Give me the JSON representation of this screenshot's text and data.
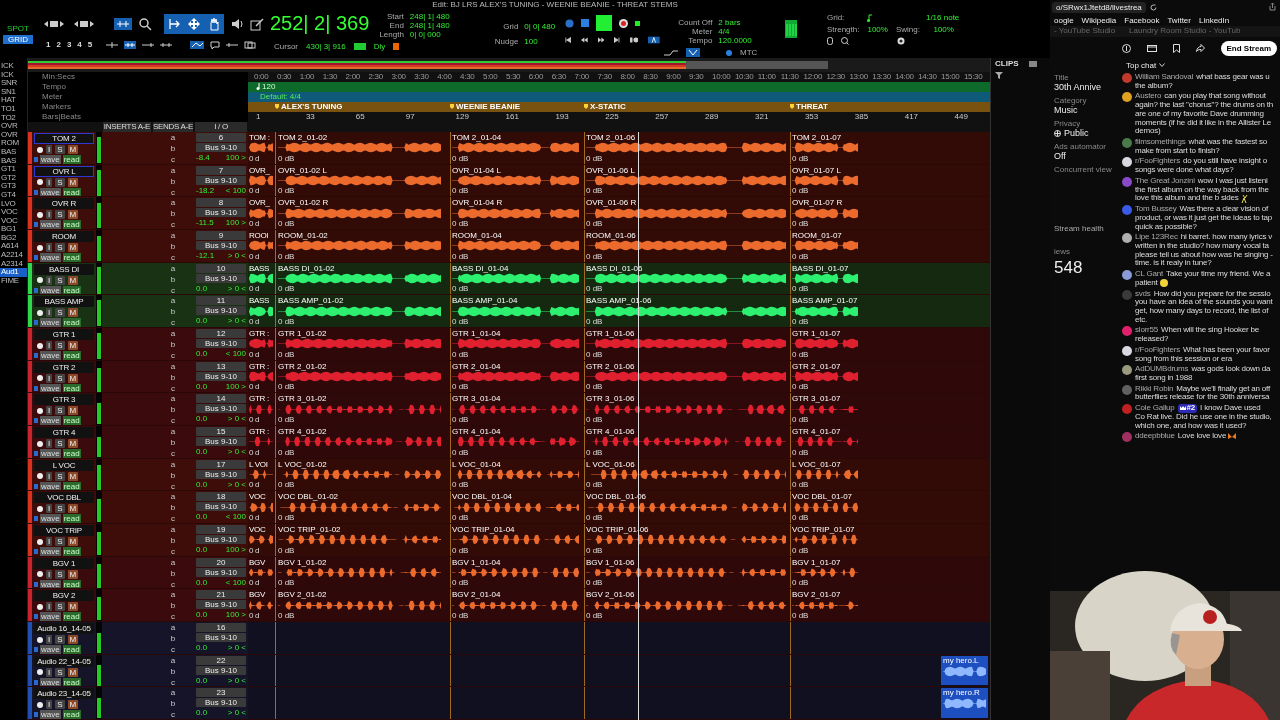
{
  "toolbar": {
    "title": "Edit: BJ LRS ALEX'S TUNING - WEENIE BEANIE - THREAT STEMS",
    "edit_modes": [
      {
        "label": "SPOT",
        "selected": false
      },
      {
        "label": "GRID",
        "selected": true
      }
    ],
    "zoom_presets": [
      "1",
      "2",
      "3",
      "4",
      "5"
    ],
    "main_counter": "252| 2| 369",
    "selection": [
      {
        "label": "Start",
        "value": "248| 1| 480"
      },
      {
        "label": "End",
        "value": "248| 1| 480"
      },
      {
        "label": "Length",
        "value": "0| 0| 000"
      }
    ],
    "cursor": {
      "label": "Cursor",
      "value": "430| 3| 916"
    },
    "dly": "Dly",
    "grid": {
      "label": "Grid",
      "value": "0| 0| 480"
    },
    "nudge": {
      "label": "Nudge",
      "value": "100"
    },
    "count_off": [
      {
        "label": "Count Off",
        "value": "2 bars"
      },
      {
        "label": "Meter",
        "value": "4/4"
      },
      {
        "label": "Tempo",
        "value": "120.0000"
      }
    ],
    "mtc": "MTC",
    "quantize": [
      {
        "label": "Grid:",
        "value": "1/16 note"
      },
      {
        "label": "Strength:",
        "value": "100%"
      },
      {
        "label": "Swing:",
        "value": "100%"
      }
    ]
  },
  "track_list": [
    {
      "name": "ICK",
      "selected": false
    },
    {
      "name": "ICK",
      "selected": false
    },
    {
      "name": "SNR",
      "selected": false
    },
    {
      "name": "SN1",
      "selected": false
    },
    {
      "name": "HAT",
      "selected": false
    },
    {
      "name": "TO1",
      "selected": false
    },
    {
      "name": "TO2",
      "selected": false
    },
    {
      "name": "OVR",
      "selected": false
    },
    {
      "name": "OVR",
      "selected": false
    },
    {
      "name": "ROM",
      "selected": false
    },
    {
      "name": "BAS",
      "selected": false
    },
    {
      "name": "BAS",
      "selected": false
    },
    {
      "name": "GT1",
      "selected": false
    },
    {
      "name": "GT2",
      "selected": false
    },
    {
      "name": "GT3",
      "selected": false
    },
    {
      "name": "GT4",
      "selected": false
    },
    {
      "name": "LVO",
      "selected": false
    },
    {
      "name": "VOC",
      "selected": false
    },
    {
      "name": "VOC",
      "selected": false
    },
    {
      "name": "BG1",
      "selected": false
    },
    {
      "name": "BG2",
      "selected": false
    },
    {
      "name": "A614",
      "selected": false
    },
    {
      "name": "A2214",
      "selected": false
    },
    {
      "name": "A2314",
      "selected": false
    },
    {
      "name": "Aud1",
      "selected": true
    },
    {
      "name": "FIME",
      "selected": false
    }
  ],
  "rulers": {
    "min_secs": {
      "label": "Min:Secs",
      "ticks": [
        "0:00",
        "0:30",
        "1:00",
        "1:30",
        "2:00",
        "2:30",
        "3:00",
        "3:30",
        "4:00",
        "4:30",
        "5:00",
        "5:30",
        "6:00",
        "6:30",
        "7:00",
        "7:30",
        "8:00",
        "8:30",
        "9:00",
        "9:30",
        "10:00",
        "10:30",
        "11:00",
        "11:30",
        "12:00",
        "12:30",
        "13:00",
        "13:30",
        "14:00",
        "14:30",
        "15:00",
        "15:30"
      ]
    },
    "tempo": {
      "label": "Tempo",
      "value": "120"
    },
    "meter": {
      "label": "Meter",
      "value": "Default: 4/4"
    },
    "markers": {
      "label": "Markers",
      "items": [
        "ALEX'S TUNING",
        "WEENIE BEANIE",
        "X-STATIC",
        "THREAT"
      ]
    },
    "bars_beats": {
      "label": "Bars|Beats",
      "ticks": [
        "1",
        "33",
        "65",
        "97",
        "129",
        "161",
        "193",
        "225",
        "257",
        "289",
        "321",
        "353",
        "385",
        "417",
        "449"
      ]
    }
  },
  "column_headers": [
    "INSERTS A-E",
    "SENDS A-E",
    "I / O"
  ],
  "clips_panel": {
    "title": "CLIPS"
  },
  "tracks": [
    {
      "name": "TOM 2",
      "selected": true,
      "color": "#d8321e",
      "kind": "drums",
      "level": 0.9,
      "controls": [
        "I",
        "S",
        "M"
      ],
      "view": "wave",
      "automation": "read",
      "sends": [
        "a",
        "b",
        "c"
      ],
      "input": "6",
      "output": "Bus 9-10",
      "volume": "-8.4",
      "pan": "100 >",
      "clips": [
        {
          "name": "TOM :",
          "gain": "0 d"
        },
        {
          "name": "TOM 2_01-02",
          "gain": "0 dB"
        },
        {
          "name": "TOM 2_01-04",
          "gain": "0 dB"
        },
        {
          "name": "TOM 2_01-06",
          "gain": "0 dB"
        },
        {
          "name": "TOM 2_01-07",
          "gain": "0 dB"
        }
      ]
    },
    {
      "name": "OVR L",
      "selected": true,
      "color": "#d8321e",
      "kind": "drums",
      "level": 0.88,
      "controls": [
        "I",
        "S",
        "M"
      ],
      "view": "wave",
      "automation": "read",
      "sends": [
        "a",
        "b",
        "c"
      ],
      "input": "7",
      "output": "Bus 9-10",
      "volume": "-18.2",
      "pan": "< 100",
      "clips": [
        {
          "name": "OVR_",
          "gain": "0 d"
        },
        {
          "name": "OVR_01-02 L",
          "gain": "0 dB"
        },
        {
          "name": "OVR_01-04 L",
          "gain": "0 dB"
        },
        {
          "name": "OVR_01-06 L",
          "gain": "0 dB"
        },
        {
          "name": "OVR_01-07 L",
          "gain": "0 dB"
        }
      ]
    },
    {
      "name": "OVR R",
      "selected": false,
      "color": "#d8321e",
      "kind": "drums",
      "level": 0.88,
      "controls": [
        "I",
        "S",
        "M"
      ],
      "view": "wave",
      "automation": "read",
      "sends": [
        "a",
        "b",
        "c"
      ],
      "input": "8",
      "output": "Bus 9-10",
      "volume": "-11.5",
      "pan": "100 >",
      "clips": [
        {
          "name": "OVR_",
          "gain": "0 d"
        },
        {
          "name": "OVR_01-02 R",
          "gain": "0 dB"
        },
        {
          "name": "OVR_01-04 R",
          "gain": "0 dB"
        },
        {
          "name": "OVR_01-06 R",
          "gain": "0 dB"
        },
        {
          "name": "OVR_01-07 R",
          "gain": "0 dB"
        }
      ]
    },
    {
      "name": "ROOM",
      "selected": false,
      "color": "#d8321e",
      "kind": "drums",
      "level": 0.86,
      "controls": [
        "I",
        "S",
        "M"
      ],
      "view": "wave",
      "automation": "read",
      "sends": [
        "a",
        "b",
        "c"
      ],
      "input": "9",
      "output": "Bus 9-10",
      "volume": "-12.1",
      "pan": "> 0 <",
      "clips": [
        {
          "name": "ROOI",
          "gain": "0 d"
        },
        {
          "name": "ROOM_01-02",
          "gain": "0 dB"
        },
        {
          "name": "ROOM_01-04",
          "gain": "0 dB"
        },
        {
          "name": "ROOM_01-06",
          "gain": "0 dB"
        },
        {
          "name": "ROOM_01-07",
          "gain": "0 dB"
        }
      ]
    },
    {
      "name": "BASS DI",
      "selected": false,
      "color": "#2ed84a",
      "kind": "bass",
      "level": 0.92,
      "controls": [
        "I",
        "S",
        "M"
      ],
      "view": "wave",
      "automation": "read",
      "sends": [
        "a",
        "b",
        "c"
      ],
      "input": "10",
      "output": "Bus 9-10",
      "volume": "0.0",
      "pan": "> 0 <",
      "clips": [
        {
          "name": "BASS",
          "gain": "0 d"
        },
        {
          "name": "BASS DI_01-02",
          "gain": "0 dB"
        },
        {
          "name": "BASS DI_01-04",
          "gain": "0 dB"
        },
        {
          "name": "BASS DI_01-06",
          "gain": "0 dB"
        },
        {
          "name": "BASS DI_01-07",
          "gain": "0 dB"
        }
      ]
    },
    {
      "name": "BASS AMP",
      "selected": false,
      "color": "#2ed84a",
      "kind": "bass",
      "level": 0.9,
      "controls": [
        "I",
        "S",
        "M"
      ],
      "view": "wave",
      "automation": "read",
      "sends": [
        "a",
        "b",
        "c"
      ],
      "input": "11",
      "output": "Bus 9-10",
      "volume": "0.0",
      "pan": "> 0 <",
      "clips": [
        {
          "name": "BASS",
          "gain": "0 d"
        },
        {
          "name": "BASS AMP_01-02",
          "gain": "0 dB"
        },
        {
          "name": "BASS AMP_01-04",
          "gain": "0 dB"
        },
        {
          "name": "BASS AMP_01-06",
          "gain": "0 dB"
        },
        {
          "name": "BASS AMP_01-07",
          "gain": "0 dB"
        }
      ]
    },
    {
      "name": "GTR 1",
      "selected": false,
      "color": "#c8242c",
      "kind": "guitar",
      "level": 0.9,
      "controls": [
        "I",
        "S",
        "M"
      ],
      "view": "wave",
      "automation": "read",
      "sends": [
        "a",
        "b",
        "c"
      ],
      "input": "12",
      "output": "Bus 9-10",
      "volume": "0.0",
      "pan": "< 100",
      "clips": [
        {
          "name": "GTR :",
          "gain": "0 d"
        },
        {
          "name": "GTR 1_01-02",
          "gain": "0 dB"
        },
        {
          "name": "GTR 1_01-04",
          "gain": "0 dB"
        },
        {
          "name": "GTR 1_01-06",
          "gain": "0 dB"
        },
        {
          "name": "GTR 1_01-07",
          "gain": "0 dB"
        }
      ]
    },
    {
      "name": "GTR 2",
      "selected": false,
      "color": "#c8242c",
      "kind": "guitar",
      "level": 0.8,
      "controls": [
        "I",
        "S",
        "M"
      ],
      "view": "wave",
      "automation": "read",
      "sends": [
        "a",
        "b",
        "c"
      ],
      "input": "13",
      "output": "Bus 9-10",
      "volume": "0.0",
      "pan": "100 >",
      "clips": [
        {
          "name": "GTR :",
          "gain": "0 d"
        },
        {
          "name": "GTR 2_01-02",
          "gain": "0 dB"
        },
        {
          "name": "GTR 2_01-04",
          "gain": "0 dB"
        },
        {
          "name": "GTR 2_01-06",
          "gain": "0 dB"
        },
        {
          "name": "GTR 2_01-07",
          "gain": "0 dB"
        }
      ]
    },
    {
      "name": "GTR 3",
      "selected": false,
      "color": "#c8242c",
      "kind": "guitar",
      "level": 0.75,
      "controls": [
        "I",
        "S",
        "M"
      ],
      "view": "wave",
      "automation": "read",
      "sends": [
        "a",
        "b",
        "c"
      ],
      "input": "14",
      "output": "Bus 9-10",
      "volume": "0.0",
      "pan": "> 0 <",
      "clips": [
        {
          "name": "GTR :",
          "gain": "0 d"
        },
        {
          "name": "GTR 3_01-02",
          "gain": "0 dB"
        },
        {
          "name": "GTR 3_01-04",
          "gain": "0 dB"
        },
        {
          "name": "GTR 3_01-06",
          "gain": "0 dB"
        },
        {
          "name": "GTR 3_01-07",
          "gain": "0 dB"
        }
      ]
    },
    {
      "name": "GTR 4",
      "selected": false,
      "color": "#c8242c",
      "kind": "guitar",
      "level": 0.7,
      "controls": [
        "I",
        "S",
        "M"
      ],
      "view": "wave",
      "automation": "read",
      "sends": [
        "a",
        "b",
        "c"
      ],
      "input": "15",
      "output": "Bus 9-10",
      "volume": "0.0",
      "pan": "> 0 <",
      "clips": [
        {
          "name": "GTR :",
          "gain": "0 d"
        },
        {
          "name": "GTR 4_01-02",
          "gain": "0 dB"
        },
        {
          "name": "GTR 4_01-04",
          "gain": "0 dB"
        },
        {
          "name": "GTR 4_01-06",
          "gain": "0 dB"
        },
        {
          "name": "GTR 4_01-07",
          "gain": "0 dB"
        }
      ]
    },
    {
      "name": "L VOC",
      "selected": false,
      "color": "#d8321e",
      "kind": "vocal",
      "level": 0.85,
      "controls": [
        "I",
        "S",
        "M"
      ],
      "view": "wave",
      "automation": "read",
      "sends": [
        "a",
        "b",
        "c"
      ],
      "input": "17",
      "output": "Bus 9-10",
      "volume": "0.0",
      "pan": "> 0 <",
      "clips": [
        {
          "name": "L VOI",
          "gain": "0 d"
        },
        {
          "name": "L VOC_01-02",
          "gain": "0 dB"
        },
        {
          "name": "L VOC_01-04",
          "gain": "0 dB"
        },
        {
          "name": "L VOC_01-06",
          "gain": "0 dB"
        },
        {
          "name": "L VOC_01-07",
          "gain": "0 dB"
        }
      ]
    },
    {
      "name": "VOC DBL",
      "selected": false,
      "color": "#d8321e",
      "kind": "vocal",
      "level": 0.8,
      "controls": [
        "I",
        "S",
        "M"
      ],
      "view": "wave",
      "automation": "read",
      "sends": [
        "a",
        "b",
        "c"
      ],
      "input": "18",
      "output": "Bus 9-10",
      "volume": "0.0",
      "pan": "< 100",
      "clips": [
        {
          "name": "VOC",
          "gain": "0 d"
        },
        {
          "name": "VOC DBL_01-02",
          "gain": "0 dB"
        },
        {
          "name": "VOC DBL_01-04",
          "gain": "0 dB"
        },
        {
          "name": "VOC DBL_01-06",
          "gain": "0 dB"
        },
        {
          "name": "VOC DBL_01-07",
          "gain": "0 dB"
        }
      ]
    },
    {
      "name": "VOC TRIP",
      "selected": false,
      "color": "#d8321e",
      "kind": "vocal",
      "level": 0.8,
      "controls": [
        "I",
        "S",
        "M"
      ],
      "view": "wave",
      "automation": "read",
      "sends": [
        "a",
        "b",
        "c"
      ],
      "input": "19",
      "output": "Bus 9-10",
      "volume": "0.0",
      "pan": "100 >",
      "clips": [
        {
          "name": "VOC",
          "gain": "0 d"
        },
        {
          "name": "VOC TRIP_01-02",
          "gain": "0 dB"
        },
        {
          "name": "VOC TRIP_01-04",
          "gain": "0 dB"
        },
        {
          "name": "VOC TRIP_01-06",
          "gain": "0 dB"
        },
        {
          "name": "VOC TRIP_01-07",
          "gain": "0 dB"
        }
      ]
    },
    {
      "name": "BGV 1",
      "selected": false,
      "color": "#c8242c",
      "kind": "vocal",
      "level": 0.8,
      "controls": [
        "I",
        "S",
        "M"
      ],
      "view": "wave",
      "automation": "read",
      "sends": [
        "a",
        "b",
        "c"
      ],
      "input": "20",
      "output": "Bus 9-10",
      "volume": "0.0",
      "pan": "< 100",
      "clips": [
        {
          "name": "BGV",
          "gain": "0 d"
        },
        {
          "name": "BGV 1_01-02",
          "gain": "0 dB"
        },
        {
          "name": "BGV 1_01-04",
          "gain": "0 dB"
        },
        {
          "name": "BGV 1_01-06",
          "gain": "0 dB"
        },
        {
          "name": "BGV 1_01-07",
          "gain": "0 dB"
        }
      ]
    },
    {
      "name": "BGV 2",
      "selected": false,
      "color": "#c8242c",
      "kind": "vocal",
      "level": 0.8,
      "controls": [
        "I",
        "S",
        "M"
      ],
      "view": "wave",
      "automation": "read",
      "sends": [
        "a",
        "b",
        "c"
      ],
      "input": "21",
      "output": "Bus 9-10",
      "volume": "0.0",
      "pan": "100 >",
      "clips": [
        {
          "name": "BGV",
          "gain": "0 d"
        },
        {
          "name": "BGV 2_01-02",
          "gain": "0 dB"
        },
        {
          "name": "BGV 2_01-04",
          "gain": "0 dB"
        },
        {
          "name": "BGV 2_01-06",
          "gain": "0 dB"
        },
        {
          "name": "BGV 2_01-07",
          "gain": "0 dB"
        }
      ]
    },
    {
      "name": "Audio 16_14-05",
      "selected": false,
      "color": "#1f4fb0",
      "kind": "aux",
      "level": 0.7,
      "controls": [
        "I",
        "S",
        "M"
      ],
      "view": "wave",
      "automation": "read",
      "sends": [
        "a",
        "b",
        "c"
      ],
      "input": "16",
      "output": "Bus 9-10",
      "volume": "0.0",
      "pan": "> 0 <"
    },
    {
      "name": "Audio 22_14-05",
      "selected": false,
      "color": "#1f4fb0",
      "kind": "aux",
      "level": 0.7,
      "controls": [
        "I",
        "S",
        "M"
      ],
      "view": "wave",
      "automation": "read",
      "sends": [
        "a",
        "b",
        "c"
      ],
      "input": "22",
      "output": "Bus 9-10",
      "volume": "0.0",
      "pan": "> 0 <",
      "clips": [
        {
          "name": "my hero.L"
        }
      ]
    },
    {
      "name": "Audio 23_14-05",
      "selected": false,
      "color": "#1f4fb0",
      "kind": "aux",
      "level": 0.7,
      "controls": [
        "I",
        "S",
        "M"
      ],
      "view": "wave",
      "automation": "read",
      "sends": [
        "a",
        "b",
        "c"
      ],
      "input": "23",
      "output": "Bus 9-10",
      "volume": "0.0",
      "pan": "> 0 <",
      "clips": [
        {
          "name": "my hero.R"
        }
      ]
    }
  ],
  "browser": {
    "url": "o/SRwx1Jtetd8/livestrea",
    "bookmarks": [
      "oogle",
      "Wikipedia",
      "Facebook",
      "Twitter",
      "LinkedIn"
    ],
    "tabs": [
      "- YouTube Studio",
      "Laundry Room Studio - YouTub"
    ]
  },
  "studio": {
    "end_stream": "End Stream",
    "chat_mode": "Top chat",
    "details": [
      {
        "label": "Title",
        "value": "30th Annive"
      },
      {
        "label": "Category",
        "value": "Music"
      },
      {
        "label": "Privacy",
        "value": "Public"
      },
      {
        "label": "Ads automator",
        "value": "Off"
      },
      {
        "label": "Concurrent view"
      }
    ],
    "stream_health": "Stream health",
    "views": {
      "label": "iews",
      "value": "548"
    },
    "messages": [
      {
        "author": "William Sandoval",
        "color": "#c0392b",
        "kind": "text",
        "lines": [
          "what bass gear was u",
          "the album?"
        ]
      },
      {
        "author": "Austero",
        "color": "#e0a020",
        "kind": "text",
        "lines": [
          "can you play that song without",
          "again? the last \"chorus\"? the drums on th",
          "are one of my favorite Dave drumming",
          "moments (if he did it like in the Allister Le",
          "demos)"
        ]
      },
      {
        "author": "filmsomethings",
        "color": "#4a7a4a",
        "kind": "text",
        "lines": [
          "what was the fastest so",
          "make from start to finish?"
        ]
      },
      {
        "author": "r/FooFighters",
        "color": "#d8d8e0",
        "kind": "text",
        "lines": [
          "do you still have insight o",
          "songs were done what days?"
        ]
      },
      {
        "author": "The Great Jonzini",
        "color": "#8a4ac8",
        "lines": [
          "wow I was just listeni",
          "the first album on the way back from the",
          "love this album and the b sides"
        ],
        "kind": "cheers"
      },
      {
        "author": "Tom Bussey",
        "color": "#3a5ae8",
        "kind": "text",
        "lines": [
          "Was there a clear vision of",
          "product, or was it just get the ideas to tap",
          "quick as possible?"
        ]
      },
      {
        "author": "Lipe 123Rec",
        "color": "#b0b0b0",
        "kind": "text",
        "lines": [
          "hi barret. how many lyrics v",
          "written in the studio? how many vocal ta",
          "please tell us about how was he singing -",
          "time. is it realy in tune?"
        ]
      },
      {
        "author": "CL Gant",
        "color": "#8a9ad8",
        "lines": [
          "Take your time my friend. We a",
          "patient"
        ],
        "kind": "smiley"
      },
      {
        "author": "svds",
        "color": "#3a3a3a",
        "kind": "text",
        "lines": [
          "How did you prepare for the sessio",
          "you have an idea of the sounds you want",
          "get, how many days to record, the list of",
          "etc."
        ]
      },
      {
        "author": "slorr55",
        "color": "#e0206a",
        "kind": "text",
        "lines": [
          "When will the sing Hooker be",
          "released?"
        ]
      },
      {
        "author": "r/FooFighters",
        "color": "#d8d8e0",
        "kind": "text",
        "lines": [
          "What has been your favor",
          "song from this session or era"
        ]
      },
      {
        "author": "AdDUMBdrums",
        "color": "#9a9a80",
        "kind": "text",
        "lines": [
          "was gods look down da",
          "first song in 1988"
        ]
      },
      {
        "author": "Rikki Robin",
        "color": "#606060",
        "kind": "text",
        "lines": [
          "Maybe we'll finally get an off",
          "butterflies release for the 30th anniversa"
        ]
      },
      {
        "author": "Cole Gallup",
        "color": "#c02020",
        "kind": "text",
        "badge": "#2",
        "lines": [
          "I know Dave used",
          "Co Rat live. Did he use one in the studio,",
          "which one, and how was it used?"
        ]
      },
      {
        "author": "ddeepbblue",
        "color": "#a03060",
        "lines": [
          "Love love love"
        ],
        "kind": "butterfly"
      }
    ]
  }
}
